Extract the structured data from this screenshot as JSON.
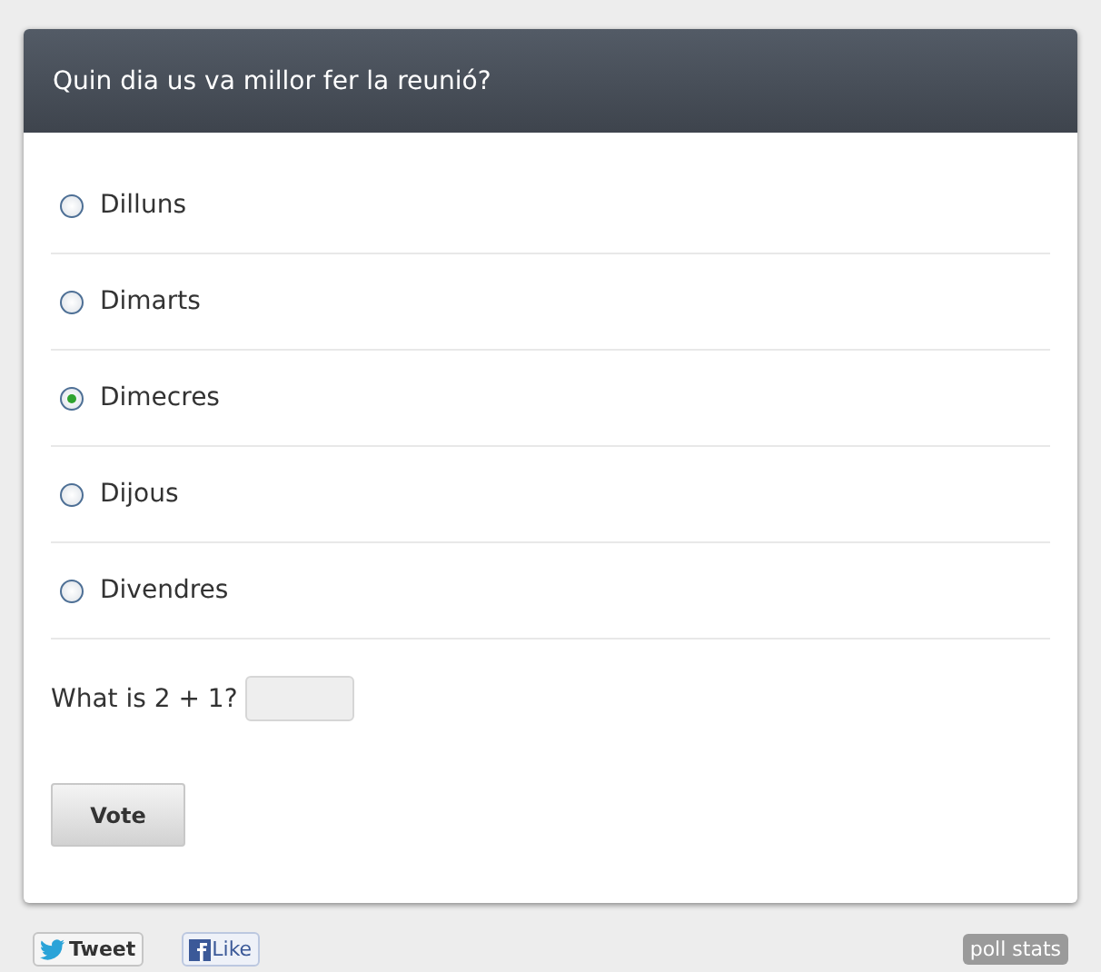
{
  "poll": {
    "question": "Quin dia us va millor fer la reunió?",
    "options": [
      {
        "label": "Dilluns",
        "selected": false
      },
      {
        "label": "Dimarts",
        "selected": false
      },
      {
        "label": "Dimecres",
        "selected": true
      },
      {
        "label": "Dijous",
        "selected": false
      },
      {
        "label": "Divendres",
        "selected": false
      }
    ],
    "captcha": {
      "label": "What is 2 + 1?"
    },
    "vote_button": "Vote"
  },
  "footer": {
    "tweet": "Tweet",
    "like": "Like",
    "stats": "poll stats"
  }
}
